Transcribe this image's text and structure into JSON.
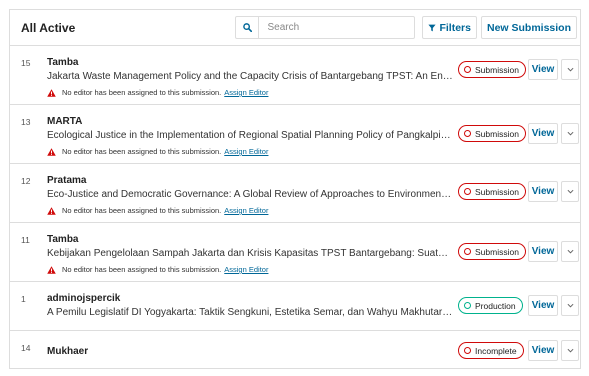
{
  "header": {
    "title": "All Active",
    "search_placeholder": "Search",
    "filters_label": "Filters",
    "new_submission_label": "New Submission"
  },
  "submissions": [
    {
      "id": "15",
      "author": "Tamba",
      "title": "Jakarta Waste Management Policy and the Capacity Crisis of Bantargebang TPST: An Environmen...",
      "warning": "No editor has been assigned to this submission.",
      "warning_link": "Assign Editor",
      "stage": "Submission",
      "stage_color": "#d00a0a",
      "view_label": "View"
    },
    {
      "id": "13",
      "author": "MARTA",
      "title": "Ecological Justice in the Implementation of Regional Spatial Planning Policy of Pangkalpinang Cit...",
      "warning": "No editor has been assigned to this submission.",
      "warning_link": "Assign Editor",
      "stage": "Submission",
      "stage_color": "#d00a0a",
      "view_label": "View"
    },
    {
      "id": "12",
      "author": "Pratama",
      "title": "Eco-Justice and Democratic Governance: A Global Review of Approaches to Environmental Sustai...",
      "warning": "No editor has been assigned to this submission.",
      "warning_link": "Assign Editor",
      "stage": "Submission",
      "stage_color": "#d00a0a",
      "view_label": "View"
    },
    {
      "id": "11",
      "author": "Tamba",
      "title": "Kebijakan Pengelolaan Sampah Jakarta dan Krisis Kapasitas TPST Bantargebang: Suatu Tinjauan ...",
      "warning": "No editor has been assigned to this submission.",
      "warning_link": "Assign Editor",
      "stage": "Submission",
      "stage_color": "#d00a0a",
      "view_label": "View"
    },
    {
      "id": "1",
      "author": "adminojspercik",
      "title": "A Pemilu Legislatif DI Yogyakarta: Taktik Sengkuni, Estetika Semar, dan Wahyu Makhutarama: Tak...",
      "stage": "Production",
      "stage_color": "#00b28d",
      "view_label": "View"
    },
    {
      "id": "14",
      "author": "Mukhaer",
      "stage": "Incomplete",
      "stage_color": "#d00a0a",
      "view_label": "View"
    }
  ],
  "colors": {
    "accent": "#006798",
    "warning": "#d00a0a",
    "production": "#00b28d",
    "border": "#dddddd"
  },
  "icons": {
    "search": "search-icon",
    "filter": "filter-icon",
    "warning": "warning-icon",
    "expand": "chevron-down-icon"
  }
}
